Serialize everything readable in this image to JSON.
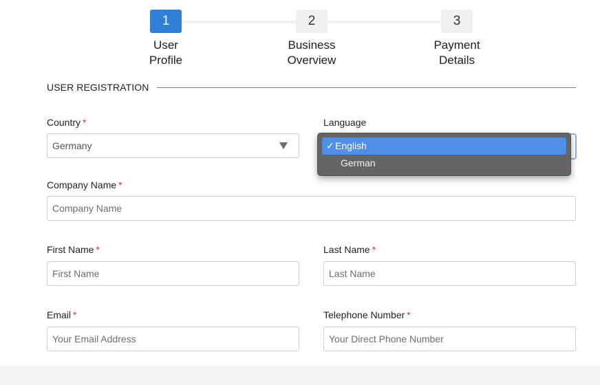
{
  "stepper": {
    "steps": [
      {
        "number": "1",
        "label": "User Profile",
        "active": true
      },
      {
        "number": "2",
        "label": "Business Overview",
        "active": false
      },
      {
        "number": "3",
        "label": "Payment Details",
        "active": false
      }
    ]
  },
  "section": {
    "title": "USER REGISTRATION"
  },
  "required_mark": "*",
  "fields": {
    "country": {
      "label": "Country",
      "value": "Germany",
      "required": true
    },
    "language": {
      "label": "Language",
      "options": [
        "English",
        "German"
      ],
      "selected": "English",
      "check_glyph": "✓"
    },
    "company_name": {
      "label": "Company Name",
      "placeholder": "Company Name",
      "required": true
    },
    "first_name": {
      "label": "First Name",
      "placeholder": "First Name",
      "required": true
    },
    "last_name": {
      "label": "Last Name",
      "placeholder": "Last Name",
      "required": true
    },
    "email": {
      "label": "Email",
      "placeholder": "Your Email Address",
      "required": true
    },
    "telephone": {
      "label": "Telephone Number",
      "placeholder": "Your Direct Phone Number",
      "required": true
    }
  },
  "colors": {
    "accent": "#2f7fd6",
    "required": "#d32f2f",
    "dropdown_bg": "#646464",
    "dropdown_selected": "#4f8fe6"
  }
}
